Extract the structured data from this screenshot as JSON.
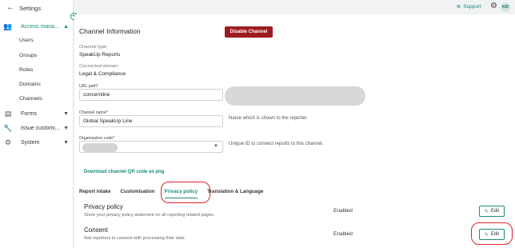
{
  "sidebar": {
    "back_label": "Settings",
    "items": [
      {
        "label": "Access mana...",
        "icon": "users-icon"
      },
      {
        "label": "Forms",
        "icon": "document-icon"
      },
      {
        "label": "Issue customi...",
        "icon": "wrench-icon"
      },
      {
        "label": "System",
        "icon": "gear-icon"
      }
    ],
    "sub_items": [
      "Users",
      "Groups",
      "Roles",
      "Domains",
      "Channels"
    ]
  },
  "topbar": {
    "support_label": "Support",
    "avatar_initials": "KD"
  },
  "page": {
    "title": "Channel Information",
    "disable_label": "Disable Channel",
    "channel_type_label": "Channel type",
    "channel_type_value": "SpeakUp Reports",
    "connected_domain_label": "Connected domain",
    "connected_domain_value": "Legal & Compliance",
    "url_path_label": "URL path*",
    "url_path_value": "concernline",
    "channel_name_label": "Channel name*",
    "channel_name_value": "Global SpeakUp Line",
    "channel_name_hint": "Name which is shown to the reporter.",
    "org_code_label": "Organisation code*",
    "org_code_hint": "Unique ID to connect reports to this channel.",
    "download_label": "Download channel QR code as png"
  },
  "tabs": [
    "Report intake",
    "Customisation",
    "Privacy policy",
    "Translation & Language"
  ],
  "rows": [
    {
      "title": "Privacy policy",
      "desc": "Show your privacy policy statement on all reporting related pages.",
      "status": "Enabled",
      "edit": "Edit"
    },
    {
      "title": "Consent",
      "desc": "Ask reporters to consent with processing their data",
      "status": "Enabled",
      "edit": "Edit"
    }
  ],
  "colors": {
    "accent": "#1f8c7a",
    "danger": "#9d1b1f",
    "highlight": "#e0242a"
  }
}
